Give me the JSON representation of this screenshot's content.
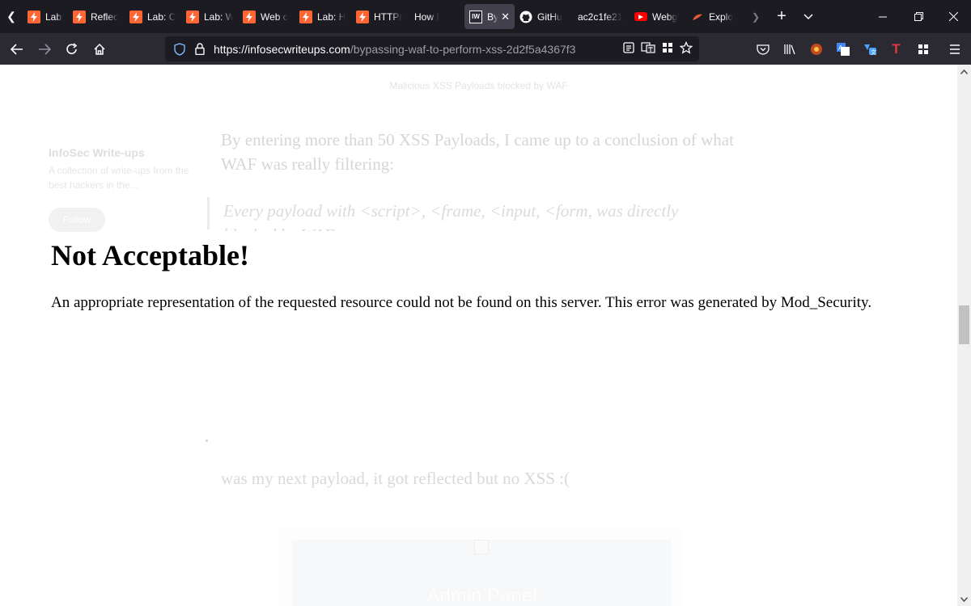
{
  "browser": {
    "tabs": [
      {
        "label": "Lab: Re",
        "favicon": "portswigger-icon"
      },
      {
        "label": "Reflec",
        "favicon": "portswigger-icon"
      },
      {
        "label": "Lab: C",
        "favicon": "portswigger-icon"
      },
      {
        "label": "Lab: W",
        "favicon": "portswigger-icon"
      },
      {
        "label": "Web c",
        "favicon": "portswigger-icon"
      },
      {
        "label": "Lab: H",
        "favicon": "portswigger-icon"
      },
      {
        "label": "HTTP/",
        "favicon": "portswigger-icon"
      },
      {
        "label": "How I",
        "favicon": "none"
      },
      {
        "label": "Byp",
        "favicon": "infosec-writeups-icon",
        "active": true,
        "close": "✕"
      },
      {
        "label": "GitHu",
        "favicon": "github-icon"
      },
      {
        "label": "ac2c1fe21",
        "favicon": "none"
      },
      {
        "label": "Webg",
        "favicon": "youtube-icon"
      },
      {
        "label": "Explo",
        "favicon": "exploit-icon"
      }
    ],
    "url": {
      "host": "https://infosecwriteups.com",
      "path": "/bypassing-waf-to-perform-xss-2d2f5a4367f3"
    },
    "accent": "#1c1b22"
  },
  "article": {
    "image_caption": "Malicious XSS Payloads blocked by WAF",
    "paragraph1": "By entering more than 50 XSS Payloads, I came up to a conclusion of what WAF was really filtering:",
    "quote": "Every payload with <script>, <frame, <input, <form, was directly blocked by WAF",
    "paragraph2": "was my next payload, it got reflected but no XSS :(",
    "image2_caption": "Admin Panel"
  },
  "publication": {
    "name": "InfoSec Write-ups",
    "description": "A collection of write-ups from the best hackers in the...",
    "follow_label": "Follow"
  },
  "error": {
    "title": "Not Acceptable!",
    "message": "An appropriate representation of the requested resource could not be found on this server. This error was generated by Mod_Security."
  }
}
